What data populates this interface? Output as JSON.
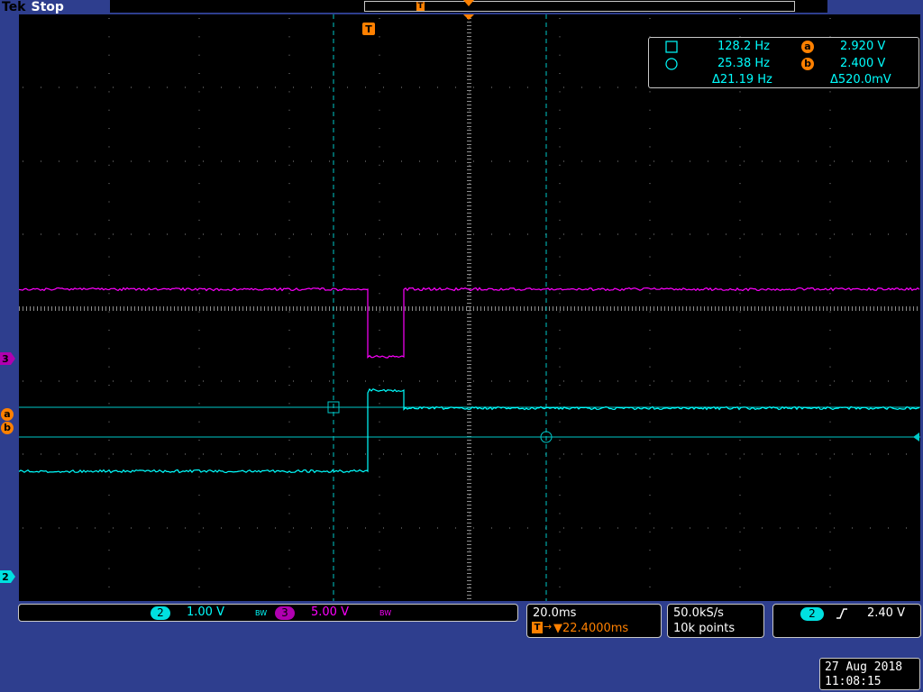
{
  "header": {
    "brand": "Tek",
    "acq_state": "Stop"
  },
  "trigger": {
    "marker_label": "T"
  },
  "measurements": {
    "cursor1_freq": "128.2 Hz",
    "cursor2_freq": "25.38 Hz",
    "delta_freq": "Δ21.19 Hz",
    "cursor_a_label": "a",
    "cursor_a_value": "2.920 V",
    "cursor_b_label": "b",
    "cursor_b_value": "2.400 V",
    "delta_volt": "Δ520.0mV"
  },
  "channels": {
    "ch2": {
      "label": "2",
      "scale": "1.00 V",
      "color": "#00ffff",
      "bw": "BW"
    },
    "ch3": {
      "label": "3",
      "scale": "5.00 V",
      "color": "#ff00ff",
      "bw": "BW"
    }
  },
  "timebase": {
    "scale": "20.0ms",
    "trigger_position": "▼22.4000ms",
    "trigger_icon": "T"
  },
  "acquisition": {
    "sample_rate": "50.0kS/s",
    "record_length": "10k points"
  },
  "trigger_settings": {
    "source": "2",
    "slope_icon": "rising-edge",
    "level": "2.40 V"
  },
  "datetime": {
    "date": "27 Aug 2018",
    "time": "11:08:15"
  },
  "colors": {
    "ch2": "#00ffff",
    "ch3": "#ff00ff",
    "trigger": "#ff8000",
    "grid": "#8c8c8c",
    "cursor": "#00c8c8"
  }
}
